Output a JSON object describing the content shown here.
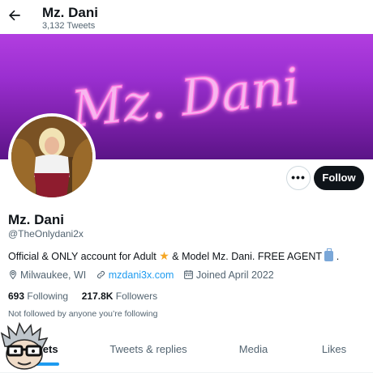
{
  "header": {
    "title": "Mz. Dani",
    "tweet_count": "3,132 Tweets"
  },
  "banner": {
    "script_text": "Mz. Dani"
  },
  "profile": {
    "name": "Mz. Dani",
    "handle": "@TheOnlydani2x",
    "bio_part1": "Official & ONLY account for Adult ",
    "bio_part2": " & Model Mz. Dani. FREE AGENT ",
    "bio_part3": " .",
    "location": "Milwaukee, WI",
    "website": "mzdani3x.com",
    "joined": "Joined April 2022",
    "following_count": "693",
    "following_label": "Following",
    "followers_count": "217.8K",
    "followers_label": "Followers",
    "followed_note": "Not followed by anyone you’re following"
  },
  "actions": {
    "more_label": "•••",
    "follow_label": "Follow"
  },
  "tabs": [
    {
      "label": "Tweets"
    },
    {
      "label": "Tweets & replies"
    },
    {
      "label": "Media"
    },
    {
      "label": "Likes"
    }
  ],
  "colors": {
    "accent": "#1d9bf0",
    "banner": "#9a2fd0",
    "text": "#0f1419",
    "muted": "#536471"
  }
}
